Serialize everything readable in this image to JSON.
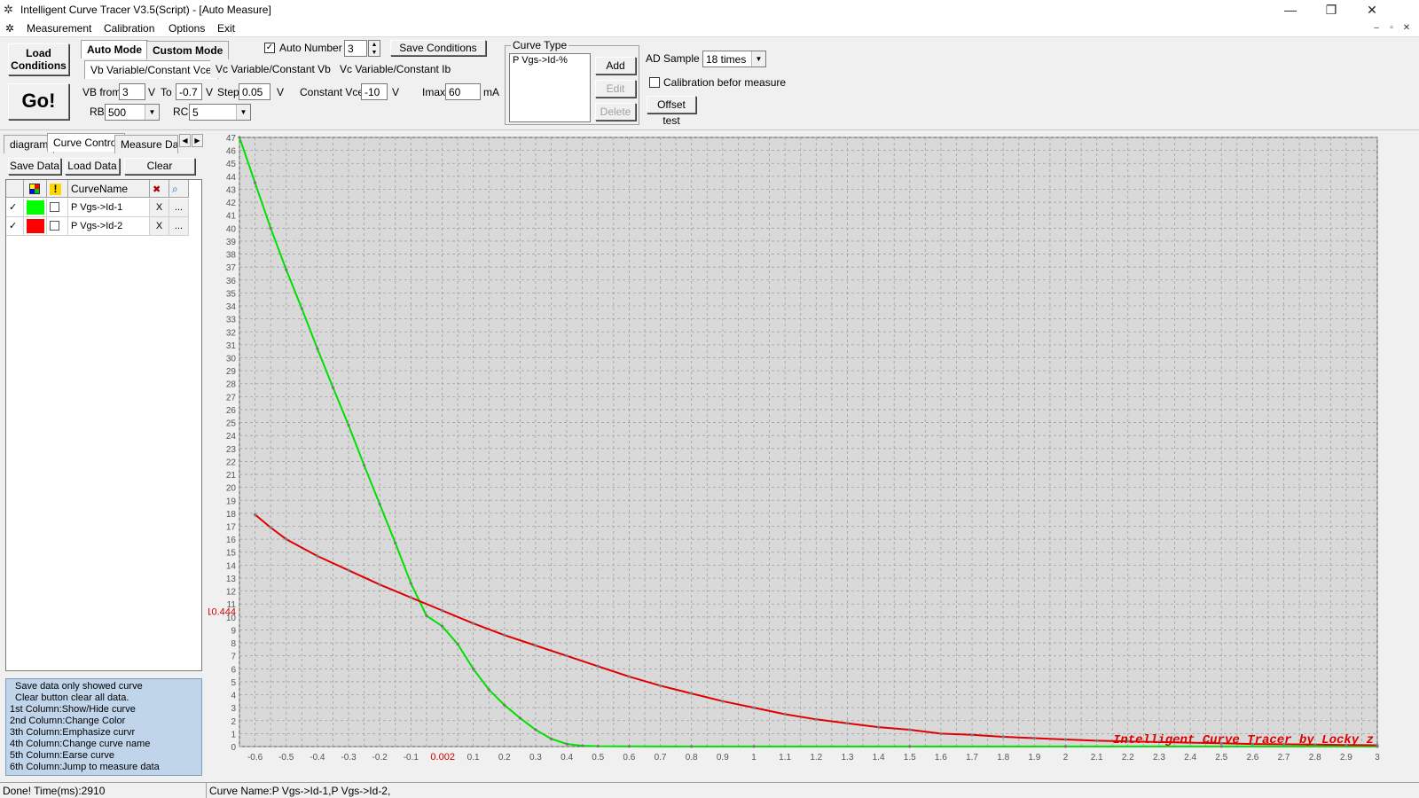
{
  "window": {
    "title": "Intelligent Curve Tracer V3.5(Script) - [Auto Measure]",
    "controls": {
      "minimize": "—",
      "restore": "❐",
      "close": "✕"
    }
  },
  "menu": {
    "items": [
      "Measurement",
      "Calibration",
      "Options",
      "Exit"
    ],
    "mdi": {
      "minimize": "–",
      "restore": "▫",
      "close": "✕"
    }
  },
  "toolbar": {
    "load_conditions": "Load Conditions",
    "go": "Go!",
    "mode_tabs": [
      "Auto Mode",
      "Custom Mode"
    ],
    "auto_number_label": "Auto Number",
    "auto_number_checked": "✓",
    "auto_number_value": "3",
    "save_conditions": "Save Conditions",
    "sub_tabs": [
      "Vb Variable/Constant Vce",
      "Vc Variable/Constant Vb",
      "Vc Variable/Constant Ib"
    ],
    "vb_from_label": "VB from",
    "vb_from": "3",
    "v1": "V",
    "to_label": "To",
    "to": "-0.7",
    "v2": "V",
    "step_label": "Step",
    "step": "0.05",
    "v3": "V",
    "constant_vce_label": "Constant Vce",
    "constant_vce": "-10",
    "v4": "V",
    "imax_label": "Imax",
    "imax": "60",
    "ma": "mA",
    "rb_label": "RB",
    "rb": "500",
    "rc_label": "RC",
    "rc": "5"
  },
  "curve_type": {
    "legend": "Curve Type",
    "items": [
      "P Vgs->Id-%"
    ],
    "add": "Add",
    "edit": "Edit",
    "delete": "Delete"
  },
  "ad": {
    "label": "AD Sample",
    "value": "18 times",
    "calibration_label": "Calibration befor measure",
    "offset_test": "Offset test"
  },
  "left": {
    "tabs": [
      "diagram",
      "Curve Control",
      "Measure Data"
    ],
    "save_data": "Save Data",
    "load_data": "Load Data",
    "clear": "Clear",
    "grid_header": {
      "name": "CurveName",
      "warn": "!"
    },
    "rows": [
      {
        "check": "✓",
        "color": "#00ff00",
        "name": "P Vgs->Id-1",
        "x": "X",
        "more": "..."
      },
      {
        "check": "✓",
        "color": "#ff0000",
        "name": "P Vgs->Id-2",
        "x": "X",
        "more": "..."
      }
    ],
    "help": [
      "Save data only showed curve",
      "Clear button clear all data.",
      "1st Column:Show/Hide curve",
      "2nd Column:Change Color",
      "3th Column:Emphasize curvr",
      "4th Column:Change curve name",
      "5th Column:Earse curve",
      "6th Column:Jump to measure data"
    ]
  },
  "chart_data": {
    "type": "line",
    "xlim": [
      -0.65,
      3.0
    ],
    "ylim": [
      0,
      47
    ],
    "x_ticks": [
      -0.6,
      -0.5,
      -0.4,
      -0.3,
      -0.2,
      -0.1,
      0.1,
      0.2,
      0.3,
      0.4,
      0.5,
      0.6,
      0.7,
      0.8,
      0.9,
      1,
      1.1,
      1.2,
      1.3,
      1.4,
      1.5,
      1.6,
      1.7,
      1.8,
      1.9,
      2,
      2.1,
      2.2,
      2.3,
      2.4,
      2.5,
      2.6,
      2.7,
      2.8,
      2.9,
      3
    ],
    "x_tick_labels": [
      "-0.6",
      "-0.5",
      "-0.4",
      "-0.3",
      "-0.2",
      "-0.1",
      "0.1",
      "0.2",
      "0.3",
      "0.4",
      "0.5",
      "0.6",
      "0.7",
      "0.8",
      "0.9",
      "1",
      "1.1",
      "1.2",
      "1.3",
      "1.4",
      "1.5",
      "1.6",
      "1.7",
      "1.8",
      "1.9",
      "2",
      "2.1",
      "2.2",
      "2.3",
      "2.4",
      "2.5",
      "2.6",
      "2.7",
      "2.8",
      "2.9",
      "3"
    ],
    "cursor_x": 0.002,
    "cursor_x_label": "0.002",
    "cursor_y": 10.444,
    "cursor_y_label": "10.444",
    "grid": true,
    "watermark": "Intelligent Curve Tracer by Locky z",
    "series": [
      {
        "name": "P Vgs->Id-1",
        "color": "#00e000",
        "x": [
          -0.65,
          -0.6,
          -0.55,
          -0.5,
          -0.45,
          -0.4,
          -0.35,
          -0.3,
          -0.25,
          -0.2,
          -0.15,
          -0.1,
          -0.05,
          0.0,
          0.05,
          0.1,
          0.15,
          0.2,
          0.25,
          0.3,
          0.35,
          0.4,
          0.45,
          0.5,
          0.6,
          0.8,
          1.0,
          1.5,
          2.0,
          2.5,
          3.0
        ],
        "y": [
          47,
          43.5,
          40,
          36.8,
          33.8,
          30.7,
          27.7,
          24.8,
          21.7,
          18.7,
          15.7,
          12.6,
          10.1,
          9.3,
          7.9,
          6.0,
          4.4,
          3.2,
          2.2,
          1.3,
          0.6,
          0.2,
          0.06,
          0.03,
          0.02,
          0.01,
          0.01,
          0.01,
          0.01,
          0.01,
          0.01
        ]
      },
      {
        "name": "P Vgs->Id-2",
        "color": "#e00000",
        "x": [
          -0.6,
          -0.55,
          -0.5,
          -0.4,
          -0.3,
          -0.2,
          -0.1,
          0.0,
          0.1,
          0.2,
          0.3,
          0.4,
          0.5,
          0.6,
          0.7,
          0.8,
          0.9,
          1.0,
          1.1,
          1.2,
          1.3,
          1.4,
          1.5,
          1.6,
          1.7,
          1.8,
          1.9,
          2.0,
          2.1,
          2.2,
          2.3,
          2.4,
          2.5,
          2.6,
          2.7,
          2.8,
          2.9,
          3.0
        ],
        "y": [
          17.9,
          16.9,
          16.0,
          14.7,
          13.6,
          12.5,
          11.5,
          10.5,
          9.5,
          8.6,
          7.8,
          7.0,
          6.2,
          5.4,
          4.7,
          4.1,
          3.5,
          3.0,
          2.5,
          2.1,
          1.8,
          1.5,
          1.3,
          1.0,
          0.9,
          0.75,
          0.65,
          0.55,
          0.45,
          0.4,
          0.35,
          0.3,
          0.25,
          0.2,
          0.18,
          0.15,
          0.12,
          0.1
        ]
      }
    ]
  },
  "status": {
    "left": "Done!  Time(ms):2910",
    "right": "Curve Name:P Vgs->Id-1,P Vgs->Id-2,"
  }
}
